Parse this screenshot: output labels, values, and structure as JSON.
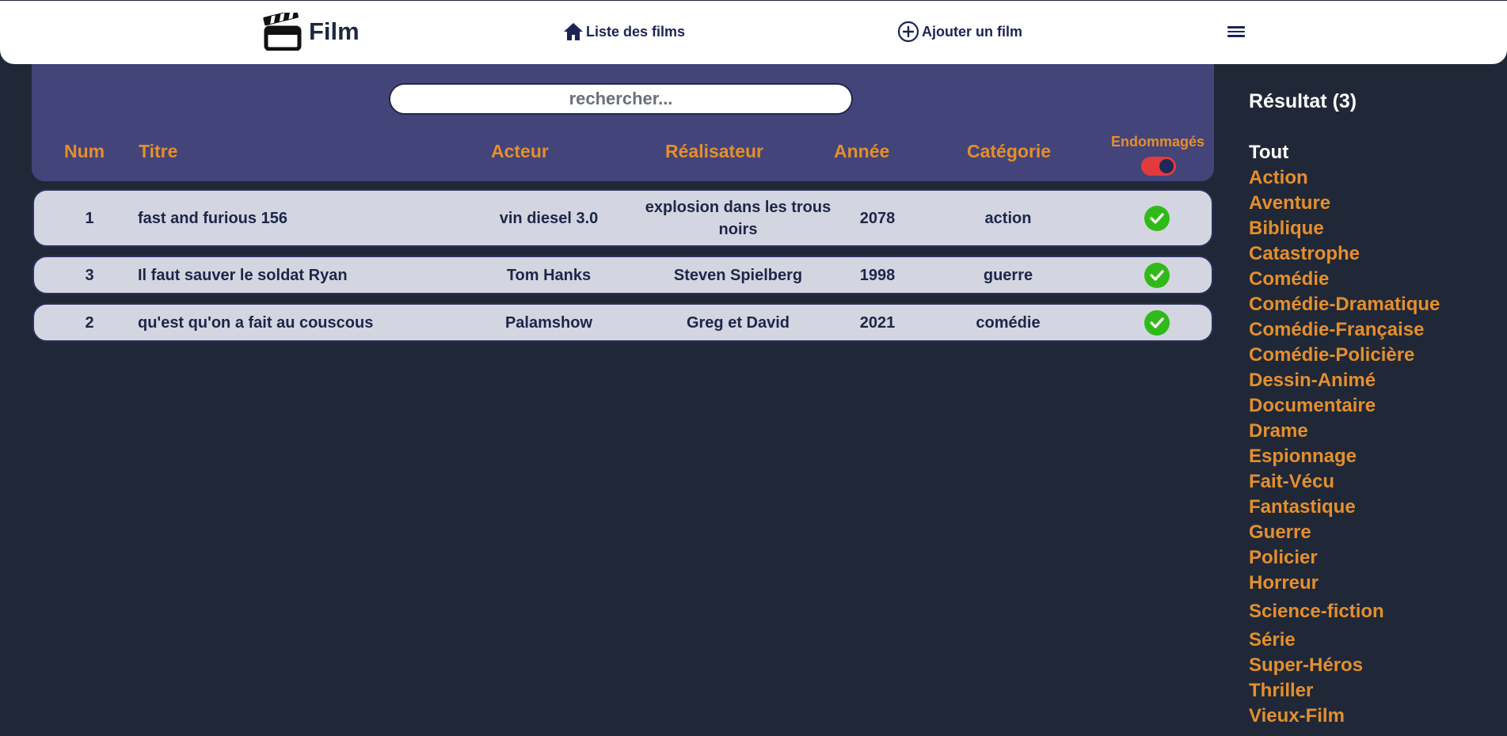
{
  "navbar": {
    "brand": "Film",
    "brand_icon": "clapperboard-icon",
    "links": [
      {
        "label": "Liste des films",
        "icon": "home-icon"
      },
      {
        "label": "Ajouter un film",
        "icon": "add-circle-icon"
      }
    ],
    "menu_icon": "hamburger-menu-icon"
  },
  "search": {
    "placeholder": "rechercher..."
  },
  "table": {
    "headers": {
      "num": "Num",
      "title": "Titre",
      "actor": "Acteur",
      "director": "Réalisateur",
      "year": "Année",
      "category": "Catégorie",
      "damaged": "Endommagés"
    },
    "damaged_toggle_on": true,
    "rows": [
      {
        "num": "1",
        "title": "fast and furious 156",
        "actor": "vin diesel 3.0",
        "director": "explosion dans les trous noirs",
        "year": "2078",
        "category": "action",
        "damaged": true
      },
      {
        "num": "3",
        "title": "Il faut sauver le soldat Ryan",
        "actor": "Tom Hanks",
        "director": "Steven Spielberg",
        "year": "1998",
        "category": "guerre",
        "damaged": true
      },
      {
        "num": "2",
        "title": "qu'est qu'on a fait au couscous",
        "actor": "Palamshow",
        "director": "Greg et David",
        "year": "2021",
        "category": "comédie",
        "damaged": true
      }
    ]
  },
  "sidebar": {
    "result_label": "Résultat (3)",
    "categories": [
      "Tout",
      "Action",
      "Aventure",
      "Biblique",
      "Catastrophe",
      "Comédie",
      "Comédie-Dramatique",
      "Comédie-Française",
      "Comédie-Policière",
      "Dessin-Animé",
      "Documentaire",
      "Drame",
      "Espionnage",
      "Fait-Vécu",
      "Fantastique",
      "Guerre",
      "Policier",
      "Horreur",
      "Science-fiction",
      "Série",
      "Super-Héros",
      "Thriller",
      "Vieux-Film"
    ],
    "active_category": "Tout"
  },
  "colors": {
    "page_bg": "#202837",
    "navbar_bg": "#ffffff",
    "header_panel_bg": "#434479",
    "accent_orange": "#e48f2d",
    "row_bg": "#d3d6e0",
    "check_green": "#30ba18",
    "toggle_red": "#e23b3d",
    "text_dark": "#1d2355"
  }
}
